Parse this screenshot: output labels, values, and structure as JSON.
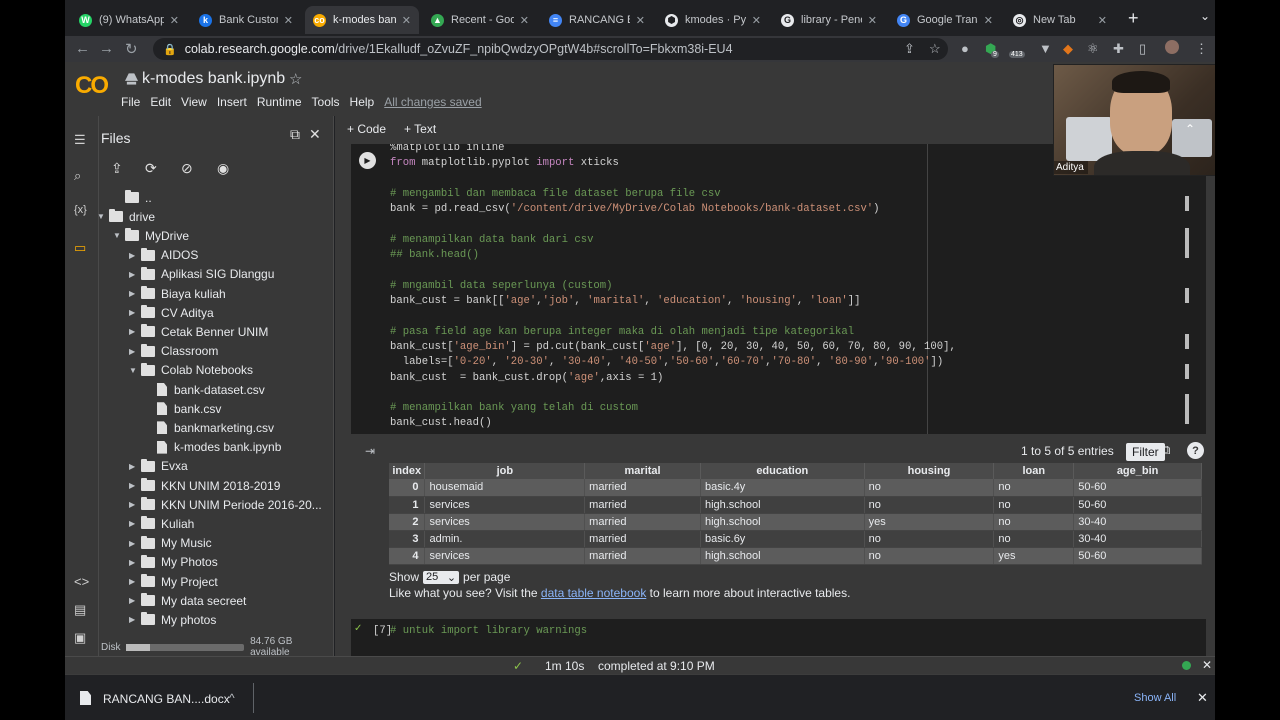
{
  "browser": {
    "tabs": [
      {
        "label": "(9) WhatsApp",
        "favicon_color": "#25d366",
        "favicon_glyph": "W"
      },
      {
        "label": "Bank Custome",
        "favicon_color": "#1a73e8",
        "favicon_glyph": "k"
      },
      {
        "label": "k-modes bank",
        "favicon_color": "#f9ab00",
        "favicon_glyph": "co",
        "active": true
      },
      {
        "label": "Recent - Goog",
        "favicon_color": "#34a853",
        "favicon_glyph": "▲"
      },
      {
        "label": "RANCANG BA",
        "favicon_color": "#4285f4",
        "favicon_glyph": "≡"
      },
      {
        "label": "kmodes · PyPI",
        "favicon_color": "#e8eaed",
        "favicon_glyph": "⬢"
      },
      {
        "label": "library - Penel",
        "favicon_color": "#e8eaed",
        "favicon_glyph": "G"
      },
      {
        "label": "Google Transl",
        "favicon_color": "#4285f4",
        "favicon_glyph": "G"
      },
      {
        "label": "New Tab",
        "favicon_color": "#e8eaed",
        "favicon_glyph": "◎"
      }
    ],
    "url_host": "colab.research.google.com",
    "url_path": "/drive/1Ekalludf_oZvuZF_npibQwdzyOPgtW4b#scrollTo=Fbkxm38i-EU4",
    "extension_badge": "413",
    "extension_badge_small": "9"
  },
  "colab": {
    "logo": "CO",
    "title": "k-modes bank.ipynb",
    "menu": [
      "File",
      "Edit",
      "View",
      "Insert",
      "Runtime",
      "Tools",
      "Help"
    ],
    "saved_status": "All changes saved",
    "add_code": "+ Code",
    "add_text": "+ Text"
  },
  "files_panel": {
    "title": "Files",
    "tree": [
      {
        "label": "..",
        "type": "up",
        "depth": 0
      },
      {
        "label": "drive",
        "type": "folder",
        "depth": 0,
        "expanded": true
      },
      {
        "label": "MyDrive",
        "type": "folder",
        "depth": 1,
        "expanded": true
      },
      {
        "label": "AIDOS",
        "type": "folder",
        "depth": 2
      },
      {
        "label": "Aplikasi SIG Dlanggu",
        "type": "folder",
        "depth": 2
      },
      {
        "label": "Biaya kuliah",
        "type": "folder",
        "depth": 2
      },
      {
        "label": "CV Aditya",
        "type": "folder",
        "depth": 2
      },
      {
        "label": "Cetak Benner UNIM",
        "type": "folder",
        "depth": 2
      },
      {
        "label": "Classroom",
        "type": "folder",
        "depth": 2
      },
      {
        "label": "Colab Notebooks",
        "type": "folder",
        "depth": 2,
        "expanded": true
      },
      {
        "label": "bank-dataset.csv",
        "type": "file",
        "depth": 3
      },
      {
        "label": "bank.csv",
        "type": "file",
        "depth": 3
      },
      {
        "label": "bankmarketing.csv",
        "type": "file",
        "depth": 3
      },
      {
        "label": "k-modes bank.ipynb",
        "type": "file",
        "depth": 3
      },
      {
        "label": "Evxa",
        "type": "folder",
        "depth": 2
      },
      {
        "label": "KKN UNIM 2018-2019",
        "type": "folder",
        "depth": 2
      },
      {
        "label": "KKN UNIM Periode 2016-20...",
        "type": "folder",
        "depth": 2
      },
      {
        "label": "Kuliah",
        "type": "folder",
        "depth": 2
      },
      {
        "label": "My Music",
        "type": "folder",
        "depth": 2
      },
      {
        "label": "My Photos",
        "type": "folder",
        "depth": 2
      },
      {
        "label": "My Project",
        "type": "folder",
        "depth": 2
      },
      {
        "label": "My data secreet",
        "type": "folder",
        "depth": 2
      },
      {
        "label": "My photos",
        "type": "folder",
        "depth": 2
      }
    ],
    "disk_label": "Disk",
    "disk_available": "84.76 GB available",
    "disk_used_fraction": 0.2
  },
  "code_cell": {
    "lines": [
      "%matplotlib inline",
      "from matplotlib.pyplot import xticks",
      "",
      "# mengambil dan membaca file dataset berupa file csv",
      "bank = pd.read_csv('/content/drive/MyDrive/Colab Notebooks/bank-dataset.csv')",
      "",
      "# menampilkan data bank dari csv",
      "## bank.head()",
      "",
      "# mngambil data seperlunya (custom)",
      "bank_cust = bank[['age','job', 'marital', 'education', 'housing', 'loan']]",
      "",
      "# pasa field age kan berupa integer maka di olah menjadi tipe kategorikal",
      "bank_cust['age_bin'] = pd.cut(bank_cust['age'], [0, 20, 30, 40, 50, 60, 70, 80, 90, 100],",
      "  labels=['0-20', '20-30', '30-40', '40-50','50-60','60-70','70-80', '80-90','90-100'])",
      "bank_cust  = bank_cust.drop('age',axis = 1)",
      "",
      "# menampilkan bank yang telah di custom",
      "bank_cust.head()"
    ]
  },
  "output": {
    "entries_text": "1 to 5 of 5 entries",
    "filter_label": "Filter",
    "columns": [
      "index",
      "job",
      "marital",
      "education",
      "housing",
      "loan",
      "age_bin"
    ],
    "rows": [
      [
        "0",
        "housemaid",
        "married",
        "basic.4y",
        "no",
        "no",
        "50-60"
      ],
      [
        "1",
        "services",
        "married",
        "high.school",
        "no",
        "no",
        "50-60"
      ],
      [
        "2",
        "services",
        "married",
        "high.school",
        "yes",
        "no",
        "30-40"
      ],
      [
        "3",
        "admin.",
        "married",
        "basic.6y",
        "no",
        "no",
        "30-40"
      ],
      [
        "4",
        "services",
        "married",
        "high.school",
        "no",
        "yes",
        "50-60"
      ]
    ],
    "show_label": "Show",
    "per_page_value": "25",
    "per_page_label": "per page",
    "like_text_before": "Like what you see? Visit the",
    "like_link": "data table notebook",
    "like_text_after": "to learn more about interactive tables."
  },
  "next_cell": {
    "exec_count": "[7]",
    "code": "# untuk import library warnings"
  },
  "statusbar": {
    "duration": "1m 10s",
    "completed": "completed at 9:10 PM"
  },
  "download": {
    "filename": "RANCANG BAN....docx",
    "show_all": "Show All"
  },
  "webcam": {
    "name": "Aditya"
  },
  "colors": {
    "accent_link": "#8ab4f8",
    "colab_orange": "#f9ab00",
    "status_green": "#34a853"
  }
}
